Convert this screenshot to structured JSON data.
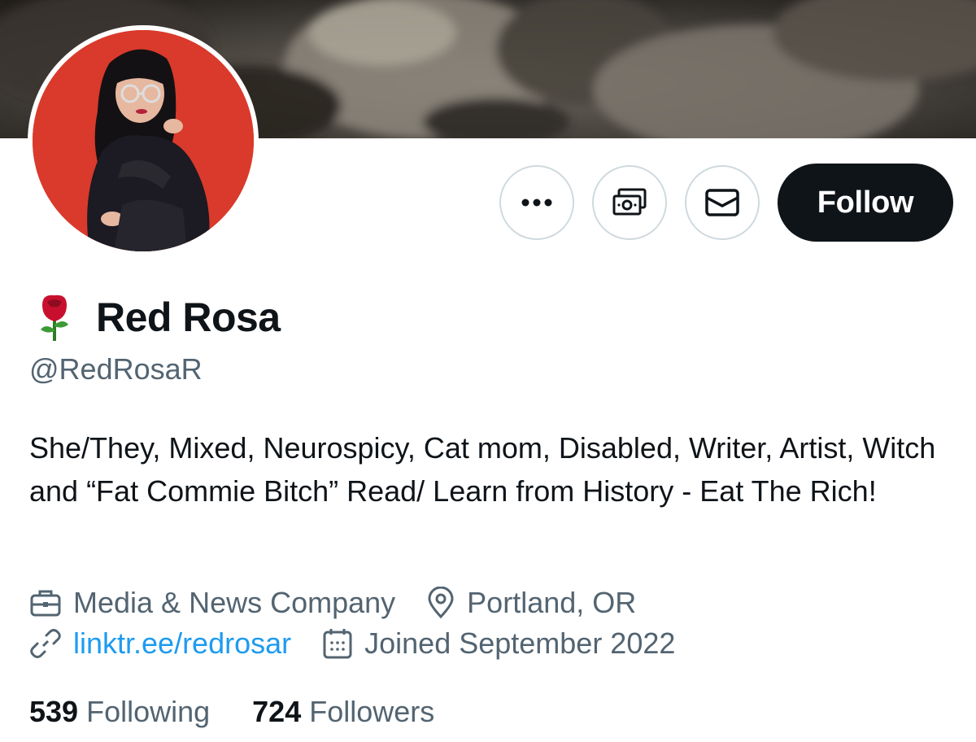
{
  "profile": {
    "display_name": "Red Rosa",
    "name_emoji": "rose-emoji",
    "handle": "@RedRosaR",
    "bio": "She/They, Mixed, Neurospicy, Cat mom, Disabled, Writer, Artist, Witch and “Fat Commie Bitch” Read/ Learn from History - Eat The Rich!",
    "category": "Media & News Company",
    "location": "Portland, OR",
    "website": "linktr.ee/redrosar",
    "joined": "Joined September 2022",
    "following_count": "539",
    "following_label": "Following",
    "followers_count": "724",
    "followers_label": "Followers"
  },
  "actions": {
    "more_icon": "ellipsis-icon",
    "tip_icon": "money-icon",
    "message_icon": "envelope-icon",
    "follow_label": "Follow"
  },
  "icons": {
    "category": "briefcase-icon",
    "location": "location-pin-icon",
    "website": "link-icon",
    "joined": "calendar-icon"
  },
  "colors": {
    "text_primary": "#0f1419",
    "text_secondary": "#536471",
    "link": "#1d9bf0",
    "follow_bg": "#0f1419",
    "avatar_bg": "#d93a2b",
    "button_border": "#cfd9de"
  }
}
